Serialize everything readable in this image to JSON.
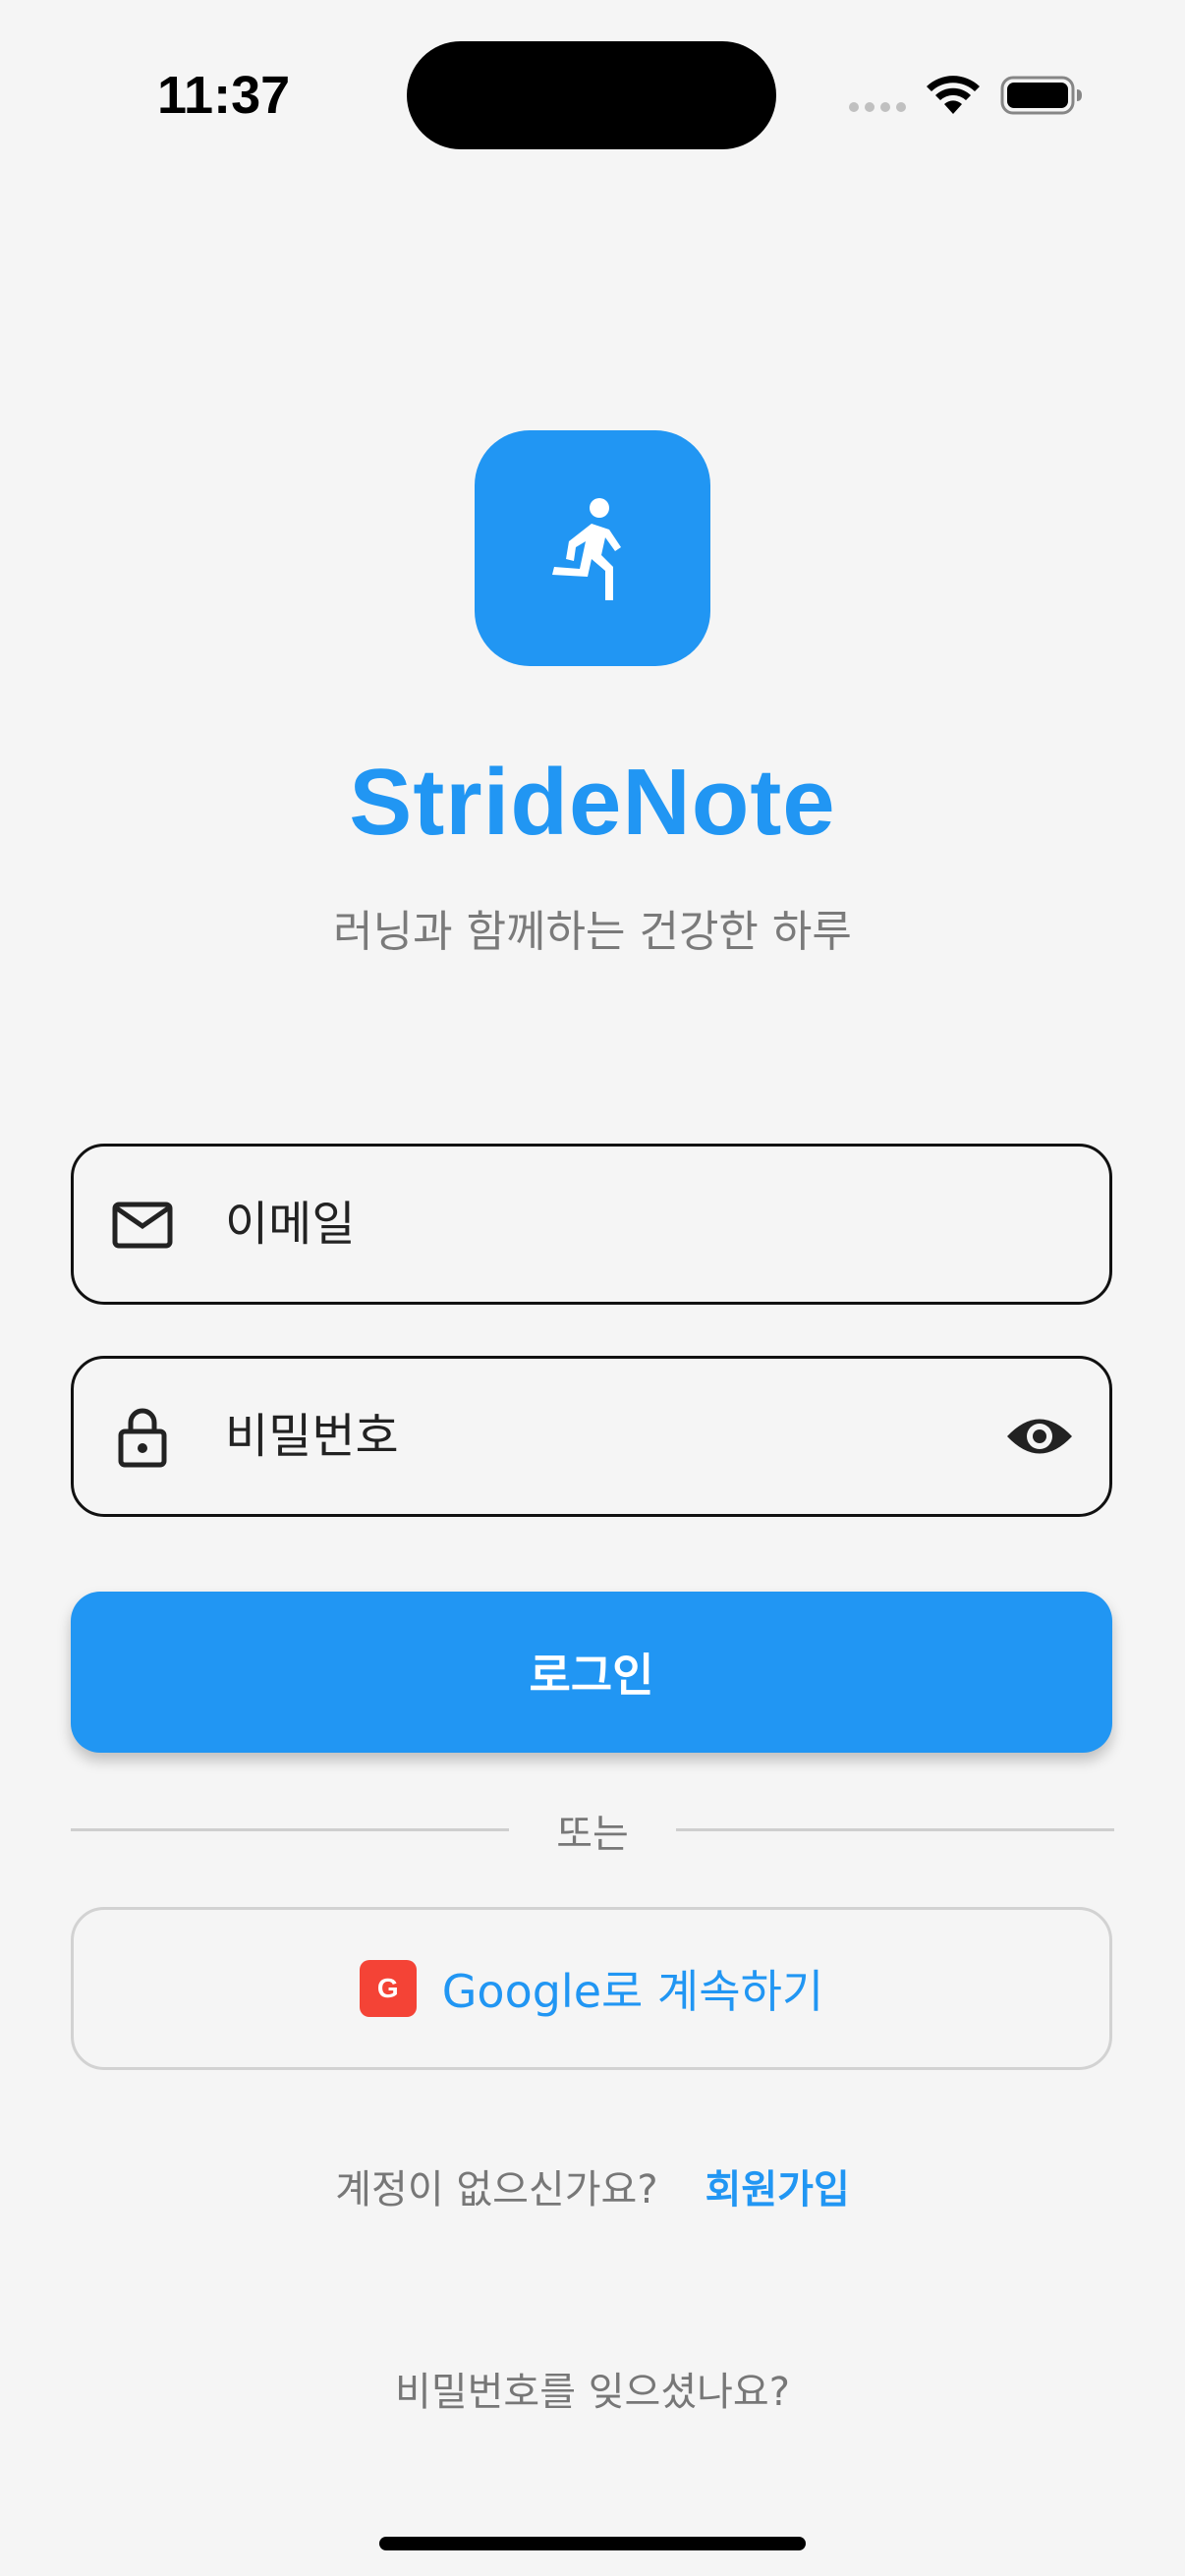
{
  "status_bar": {
    "time": "11:37",
    "icons": [
      "signal-dots-icon",
      "wifi-icon",
      "battery-icon"
    ]
  },
  "app": {
    "logo_icon": "running-person-icon",
    "title": "StrideNote",
    "subtitle": "러닝과 함께하는 건강한 하루"
  },
  "form": {
    "email": {
      "placeholder": "이메일",
      "value": "",
      "icon": "mail-icon"
    },
    "password": {
      "placeholder": "비밀번호",
      "value": "",
      "icon": "lock-icon",
      "toggle_icon": "eye-icon"
    },
    "login_label": "로그인",
    "divider_text": "또는",
    "google": {
      "badge": "G",
      "label": "Google로 계속하기"
    }
  },
  "footer": {
    "signup_prompt": "계정이 없으신가요?",
    "signup_link": "회원가입",
    "forgot_password": "비밀번호를 잊으셨나요?"
  },
  "colors": {
    "accent": "#2196f3",
    "background": "#f5f5f5",
    "google_badge": "#f44336"
  }
}
